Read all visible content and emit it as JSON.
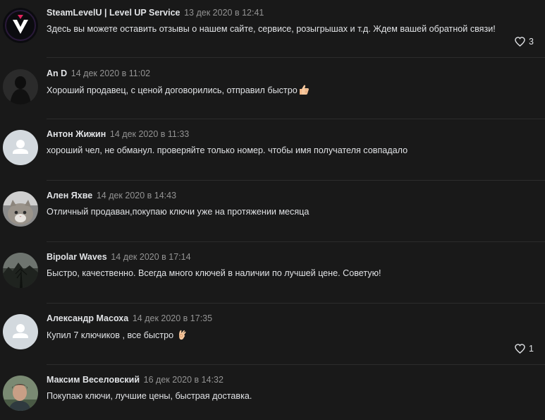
{
  "comments": [
    {
      "author": "SteamLevelU | Level UP Service",
      "date": "13 дек 2020 в 12:41",
      "text": "Здесь вы можете оставить отзывы о нашем сайте, сервисе, розыгрышах и т.д. Ждем вашей обратной связи!",
      "likes": "3",
      "avatar": "steamlevelu-logo"
    },
    {
      "author": "An D",
      "date": "14 дек 2020 в 11:02",
      "text": "Хороший продавец, с ценой договорились, отправил быстро",
      "emoji": "thumbs-up-icon",
      "avatar": "dark-figure-photo"
    },
    {
      "author": "Антон Жижин",
      "date": "14 дек 2020 в 11:33",
      "text": "хороший чел, не обманул. проверяйте только номер. чтобы имя получателя совпадало",
      "avatar": "default-user-icon"
    },
    {
      "author": "Ален Яхве",
      "date": "14 дек 2020 в 14:43",
      "text": "Отличный продаван,покупаю ключи уже на протяжении месяца",
      "avatar": "cat-photo"
    },
    {
      "author": "Bipolar Waves",
      "date": "14 дек 2020 в 17:14",
      "text": "Быстро, качественно. Всегда много ключей в наличии по лучшей цене. Советую!",
      "avatar": "dark-landscape-photo"
    },
    {
      "author": "Александр Масоха",
      "date": "14 дек 2020 в 17:35",
      "text": "Купил 7 ключиков , все быстро",
      "emoji": "ok-hand-icon",
      "likes": "1",
      "avatar": "default-user-icon"
    },
    {
      "author": "Максим Веселовский",
      "date": "16 дек 2020 в 14:32",
      "text": "Покупаю ключи, лучшие цены, быстрая доставка.",
      "avatar": "person-photo"
    }
  ],
  "colors": {
    "background": "#191919",
    "text": "#e1e3e6",
    "muted": "#939393",
    "divider": "#2c2c2c",
    "default_avatar_bg": "#d3d9de"
  }
}
